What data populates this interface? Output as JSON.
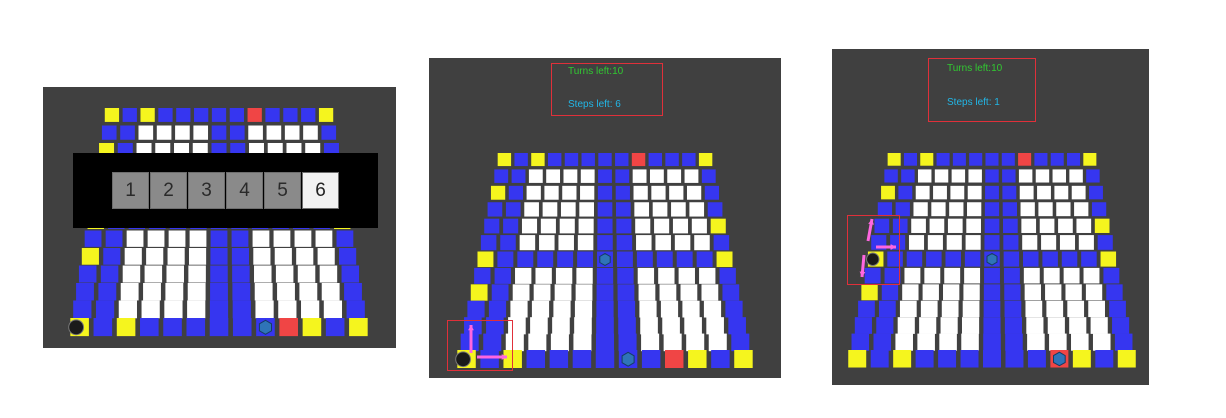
{
  "dice_selector": {
    "options": [
      "1",
      "2",
      "3",
      "4",
      "5",
      "6"
    ],
    "selected": "6"
  },
  "hud_panel_2": {
    "turns": "Turns left:10",
    "steps": "Steps left: 6"
  },
  "hud_panel_3": {
    "turns": "Turns left:10",
    "steps": "Steps left: 1"
  },
  "colors": {
    "background": "#404040",
    "tile_blue": "#3636f0",
    "tile_white": "#ffffff",
    "tile_yellow": "#f5f51e",
    "tile_red": "#f04545",
    "arrow_pink": "#ff66e0",
    "hud_turns": "#31c931",
    "hud_steps": "#22b6e6",
    "highlight_border": "#e0303a"
  },
  "pieces": {
    "player": "black-sphere",
    "other": "blue-hex-token"
  }
}
